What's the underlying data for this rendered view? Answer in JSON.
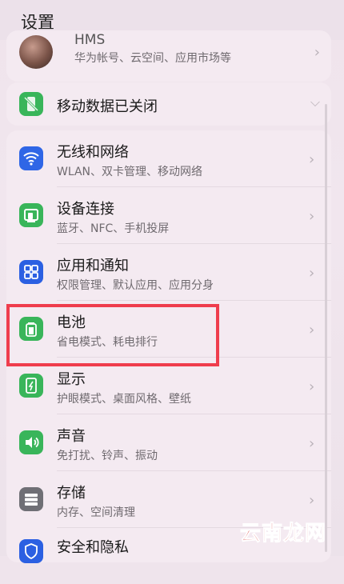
{
  "header": {
    "title": "设置"
  },
  "account": {
    "name": "HMS",
    "subtitle": "华为帐号、云空间、应用市场等"
  },
  "mobile_data": {
    "label": "移动数据已关闭"
  },
  "items": [
    {
      "title": "无线和网络",
      "subtitle": "WLAN、双卡管理、移动网络",
      "icon": "wifi-icon",
      "color": "#2f66e6"
    },
    {
      "title": "设备连接",
      "subtitle": "蓝牙、NFC、手机投屏",
      "icon": "device-connect-icon",
      "color": "#39b55a"
    },
    {
      "title": "应用和通知",
      "subtitle": "权限管理、默认应用、应用分身",
      "icon": "apps-icon",
      "color": "#2b60e2"
    },
    {
      "title": "电池",
      "subtitle": "省电模式、耗电排行",
      "icon": "battery-icon",
      "color": "#39b55a"
    },
    {
      "title": "显示",
      "subtitle": "护眼模式、桌面风格、壁纸",
      "icon": "display-icon",
      "color": "#39b55a"
    },
    {
      "title": "声音",
      "subtitle": "免打扰、铃声、振动",
      "icon": "sound-icon",
      "color": "#39b55a"
    },
    {
      "title": "存储",
      "subtitle": "内存、空间清理",
      "icon": "storage-icon",
      "color": "#6f6f75"
    },
    {
      "title": "安全和隐私",
      "subtitle": "",
      "icon": "shield-icon",
      "color": "#2b60e2"
    }
  ],
  "watermark": "云南龙网",
  "highlight_color": "#ef3d4d"
}
